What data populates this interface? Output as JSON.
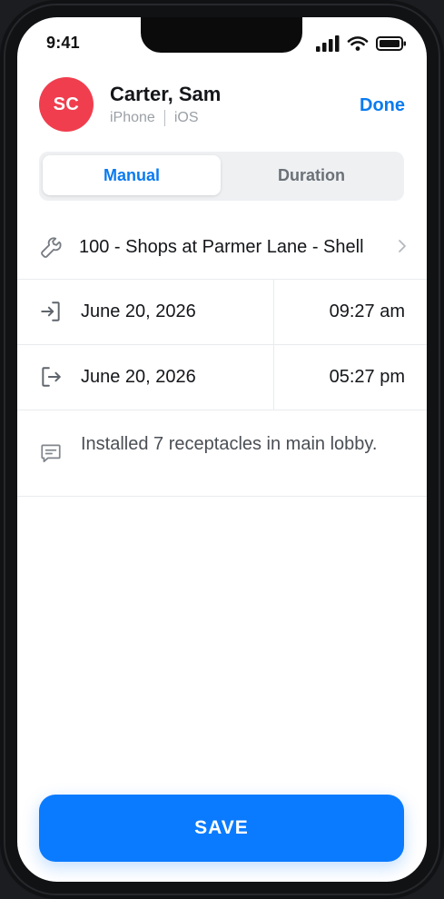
{
  "status_bar": {
    "time": "9:41",
    "icons": [
      "signal-icon",
      "wifi-icon",
      "battery-icon"
    ]
  },
  "header": {
    "avatar_initials": "SC",
    "avatar_color": "#f03e4e",
    "name": "Carter, Sam",
    "device": "iPhone",
    "os": "iOS",
    "done_label": "Done"
  },
  "tabs": {
    "items": [
      {
        "label": "Manual",
        "active": true
      },
      {
        "label": "Duration",
        "active": false
      }
    ]
  },
  "entry": {
    "job": "100 - Shops at Parmer Lane - Shell",
    "clock_in": {
      "date": "June 20, 2026",
      "time": "09:27 am"
    },
    "clock_out": {
      "date": "June 20, 2026",
      "time": "05:27 pm"
    },
    "notes": "Installed 7 receptacles in main lobby."
  },
  "actions": {
    "save_label": "SAVE"
  },
  "colors": {
    "accent": "#0a7bf0",
    "primary_button": "#0a7bff"
  }
}
